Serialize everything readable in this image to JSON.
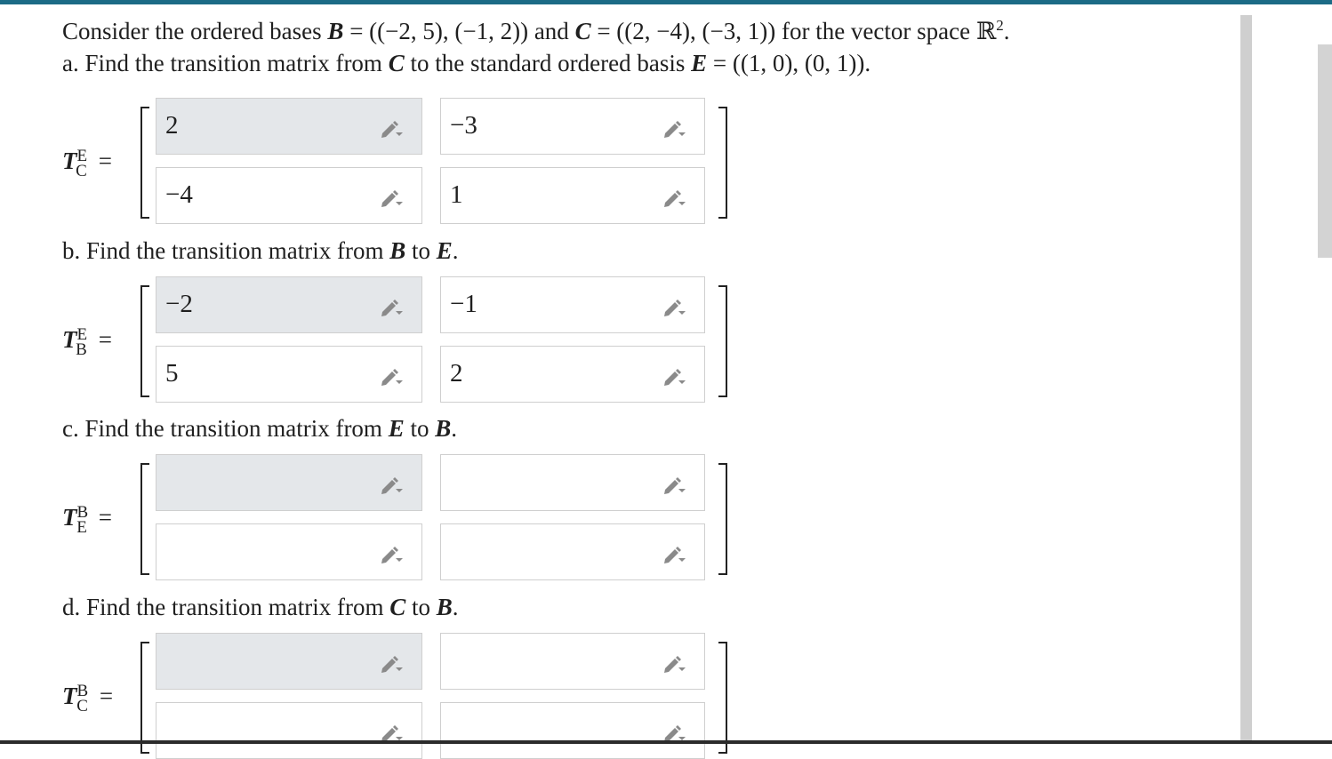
{
  "problem": {
    "intro_parts": [
      "Consider the ordered bases ",
      "B",
      " = ((−2, 5), (−1, 2)) and ",
      "C",
      " = ((2, −4), (−3, 1)) for the vector space ℝ",
      "2",
      "."
    ],
    "part_a_parts": [
      "a. Find the transition matrix from ",
      "C",
      " to the standard ordered basis ",
      "E",
      " = ((1, 0), (0, 1))."
    ],
    "part_b_parts": [
      "b. Find the transition matrix from ",
      "B",
      " to ",
      "E",
      "."
    ],
    "part_c_parts": [
      "c. Find the transition matrix from ",
      "E",
      " to ",
      "B",
      "."
    ],
    "part_d_parts": [
      "d. Find the transition matrix from ",
      "C",
      " to ",
      "B",
      "."
    ]
  },
  "matrices": [
    {
      "symbol": "T",
      "sup": "E",
      "sub": "C",
      "eq": "=",
      "cells": [
        "2",
        "−3",
        "−4",
        "1"
      ]
    },
    {
      "symbol": "T",
      "sup": "E",
      "sub": "B",
      "eq": "=",
      "cells": [
        "−2",
        "−1",
        "5",
        "2"
      ]
    },
    {
      "symbol": "T",
      "sup": "B",
      "sub": "E",
      "eq": "=",
      "cells": [
        "",
        "",
        "",
        ""
      ]
    },
    {
      "symbol": "T",
      "sup": "B",
      "sub": "C",
      "eq": "=",
      "cells": [
        "",
        "",
        "",
        ""
      ]
    }
  ],
  "icons": {
    "cell_edit": "pencil-dropdown-icon"
  },
  "colors": {
    "top_bar": "#1c6b86",
    "focused_cell": "#e4e7ea",
    "cell_border": "#cfcfcf"
  }
}
